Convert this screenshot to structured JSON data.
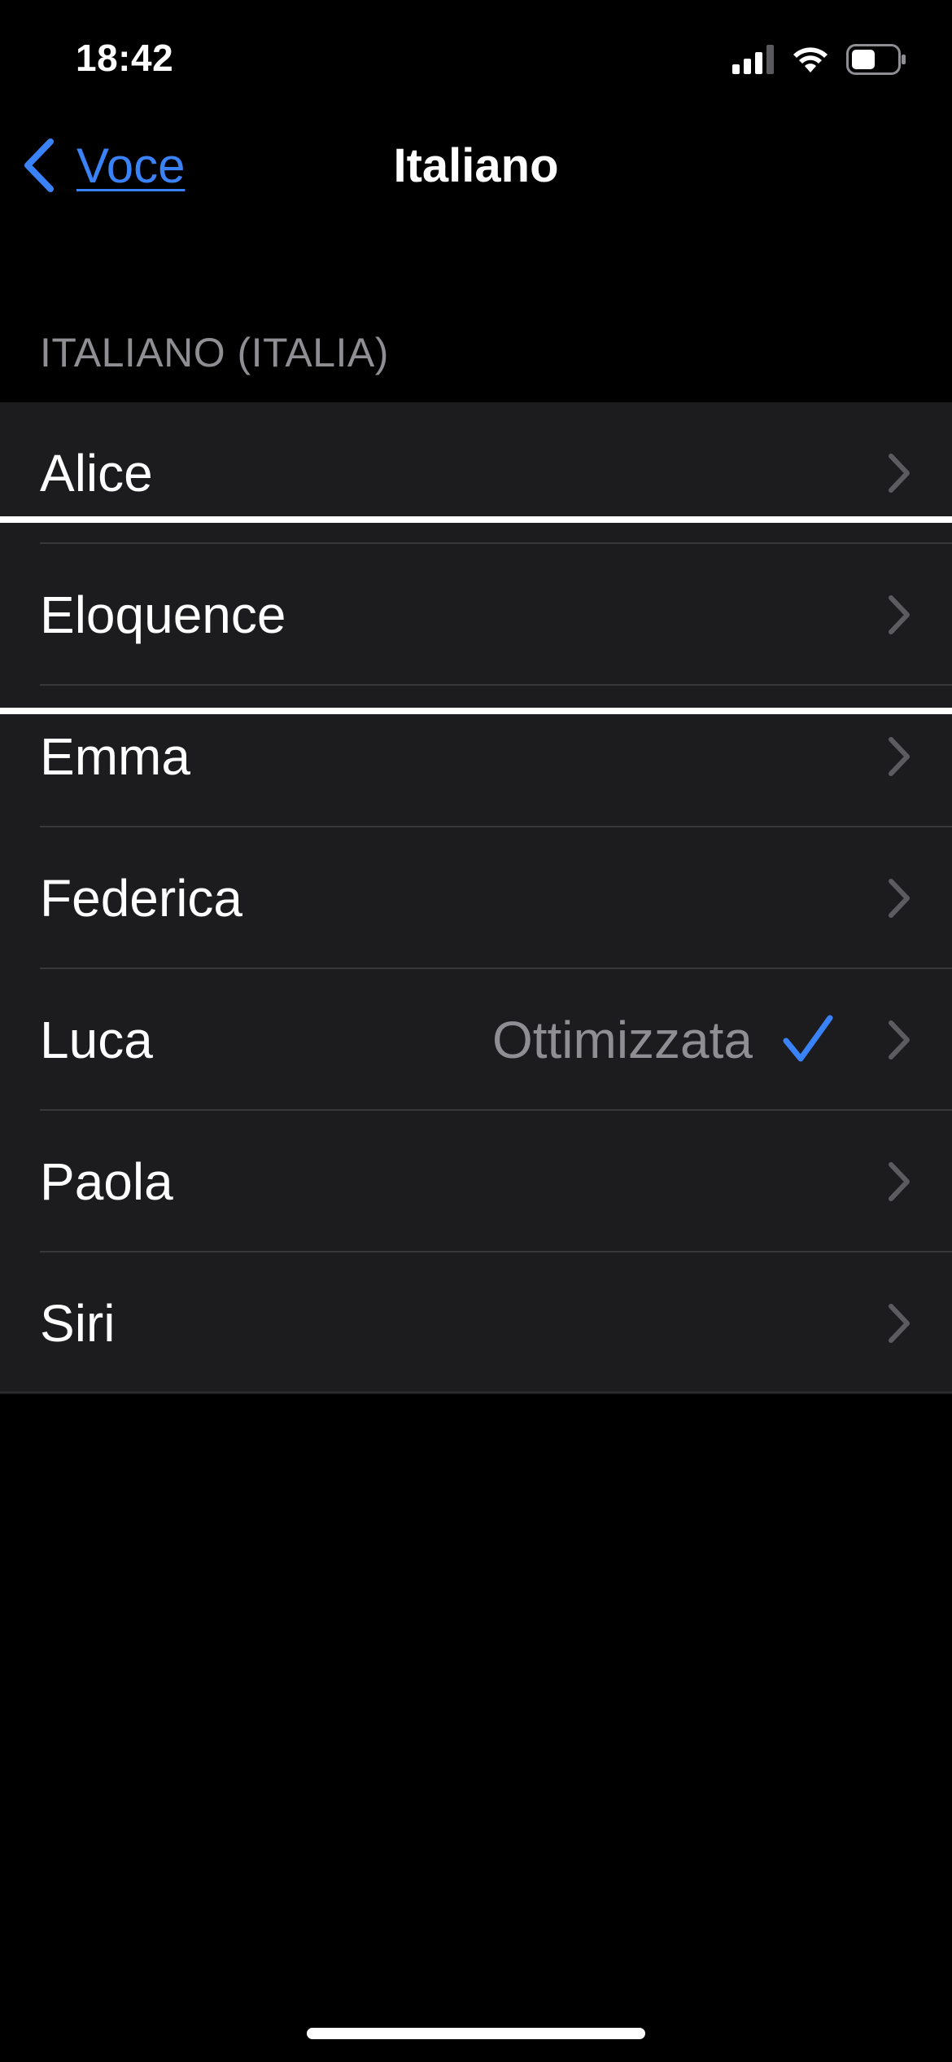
{
  "status_bar": {
    "time": "18:42"
  },
  "nav": {
    "back_label": "Voce",
    "title": "Italiano"
  },
  "section": {
    "header": "ITALIANO (ITALIA)"
  },
  "voices": [
    {
      "label": "Alice",
      "value": "",
      "selected": false
    },
    {
      "label": "Eloquence",
      "value": "",
      "selected": false
    },
    {
      "label": "Emma",
      "value": "",
      "selected": false
    },
    {
      "label": "Federica",
      "value": "",
      "selected": false
    },
    {
      "label": "Luca",
      "value": "Ottimizzata",
      "selected": true
    },
    {
      "label": "Paola",
      "value": "",
      "selected": false
    },
    {
      "label": "Siri",
      "value": "",
      "selected": false
    }
  ],
  "colors": {
    "accent": "#3a82f7",
    "background": "#000000",
    "cell": "#1c1c1e",
    "secondary_text": "#8e8e93"
  }
}
